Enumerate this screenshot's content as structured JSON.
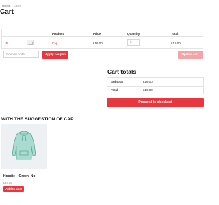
{
  "breadcrumb": "HOME / CART",
  "page_title": "Cart",
  "cart_table": {
    "headers": {
      "product": "Product",
      "price": "Price",
      "quantity": "Quantity",
      "total": "Total"
    },
    "row": {
      "remove_symbol": "×",
      "product_name": "Cap",
      "price": "£16.00",
      "quantity": "1",
      "total": "£16.00"
    }
  },
  "coupon": {
    "placeholder": "Coupon code",
    "apply_label": "Apply coupon"
  },
  "update_cart_label": "Update cart",
  "cart_totals": {
    "title": "Cart totals",
    "subtotal_label": "Subtotal",
    "subtotal_value": "£16.00",
    "total_label": "Total",
    "total_value": "£16.00",
    "checkout_label": "Proceed to checkout"
  },
  "suggestions": {
    "heading": "WITH THE SUGGESTION OF CAP",
    "product": {
      "name": "Hoodie – Green, No",
      "price": "£45.00",
      "add_label": "Add to cart",
      "image_icon": "hoodie-image"
    }
  },
  "colors": {
    "accent": "#e8373f",
    "accent_disabled": "#f4a3a6",
    "product_bg": "#eef1f3",
    "hoodie": "#8fcdc0"
  }
}
